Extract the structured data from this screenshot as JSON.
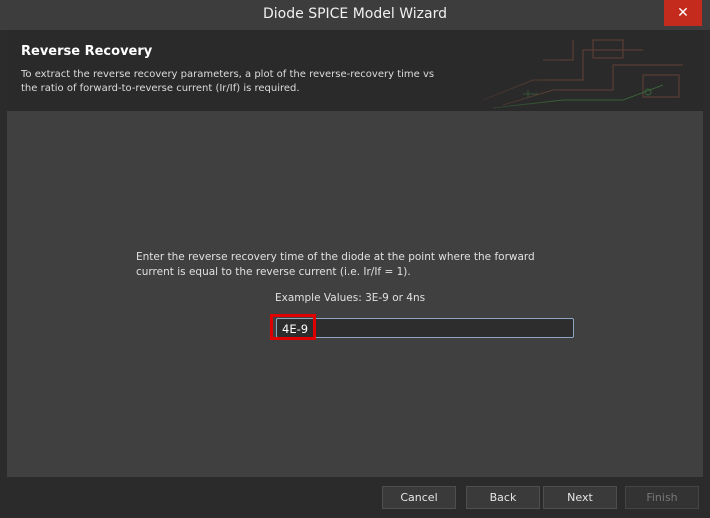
{
  "window": {
    "title": "Diode SPICE Model Wizard",
    "close_label": "✕"
  },
  "header": {
    "title": "Reverse Recovery",
    "description": "To extract the reverse recovery parameters, a plot of the reverse-recovery time vs the ratio of forward-to-reverse current (Ir/If) is required."
  },
  "content": {
    "prompt": "Enter the reverse recovery time of the diode at the point where the forward current is equal to the reverse current (i.e. Ir/If = 1).",
    "example": "Example Values: 3E-9 or 4ns",
    "input_value": "4E-9"
  },
  "footer": {
    "cancel_label": "Cancel",
    "back_label": "Back",
    "next_label": "Next",
    "finish_label": "Finish"
  },
  "colors": {
    "highlight": "#e00000",
    "close": "#c42b1c"
  }
}
